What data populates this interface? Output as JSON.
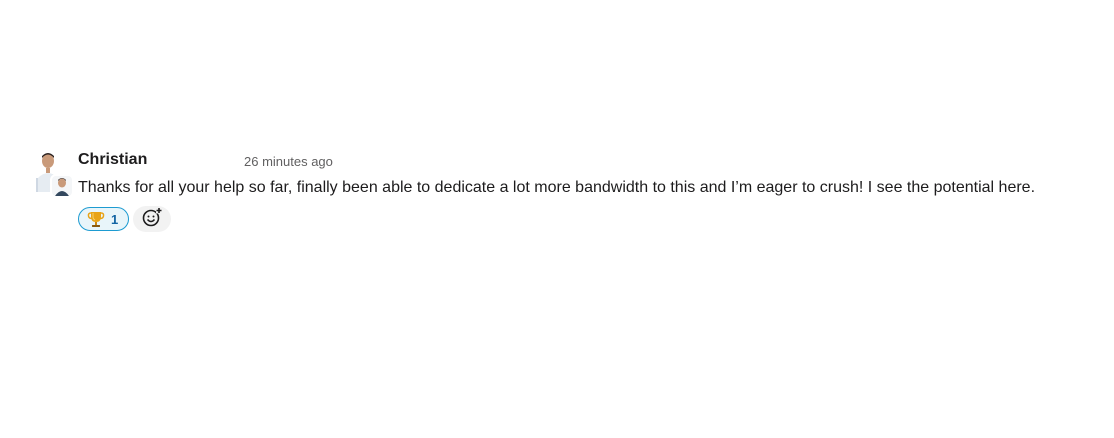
{
  "message": {
    "author": "Christian",
    "timestamp": "26 minutes ago",
    "text": "Thanks for all your help so far, finally been able to dedicate a lot more bandwidth to this and I’m eager to crush! I see the potential here.",
    "reactions": [
      {
        "emoji": "trophy-icon",
        "count": "1",
        "selected": true
      }
    ],
    "add_reaction_icon": "add-reaction-icon"
  },
  "colors": {
    "reaction_border": "#1d9bd1",
    "reaction_bg": "#e8f5fa",
    "reaction_count": "#1264a3",
    "timestamp": "#616061"
  }
}
